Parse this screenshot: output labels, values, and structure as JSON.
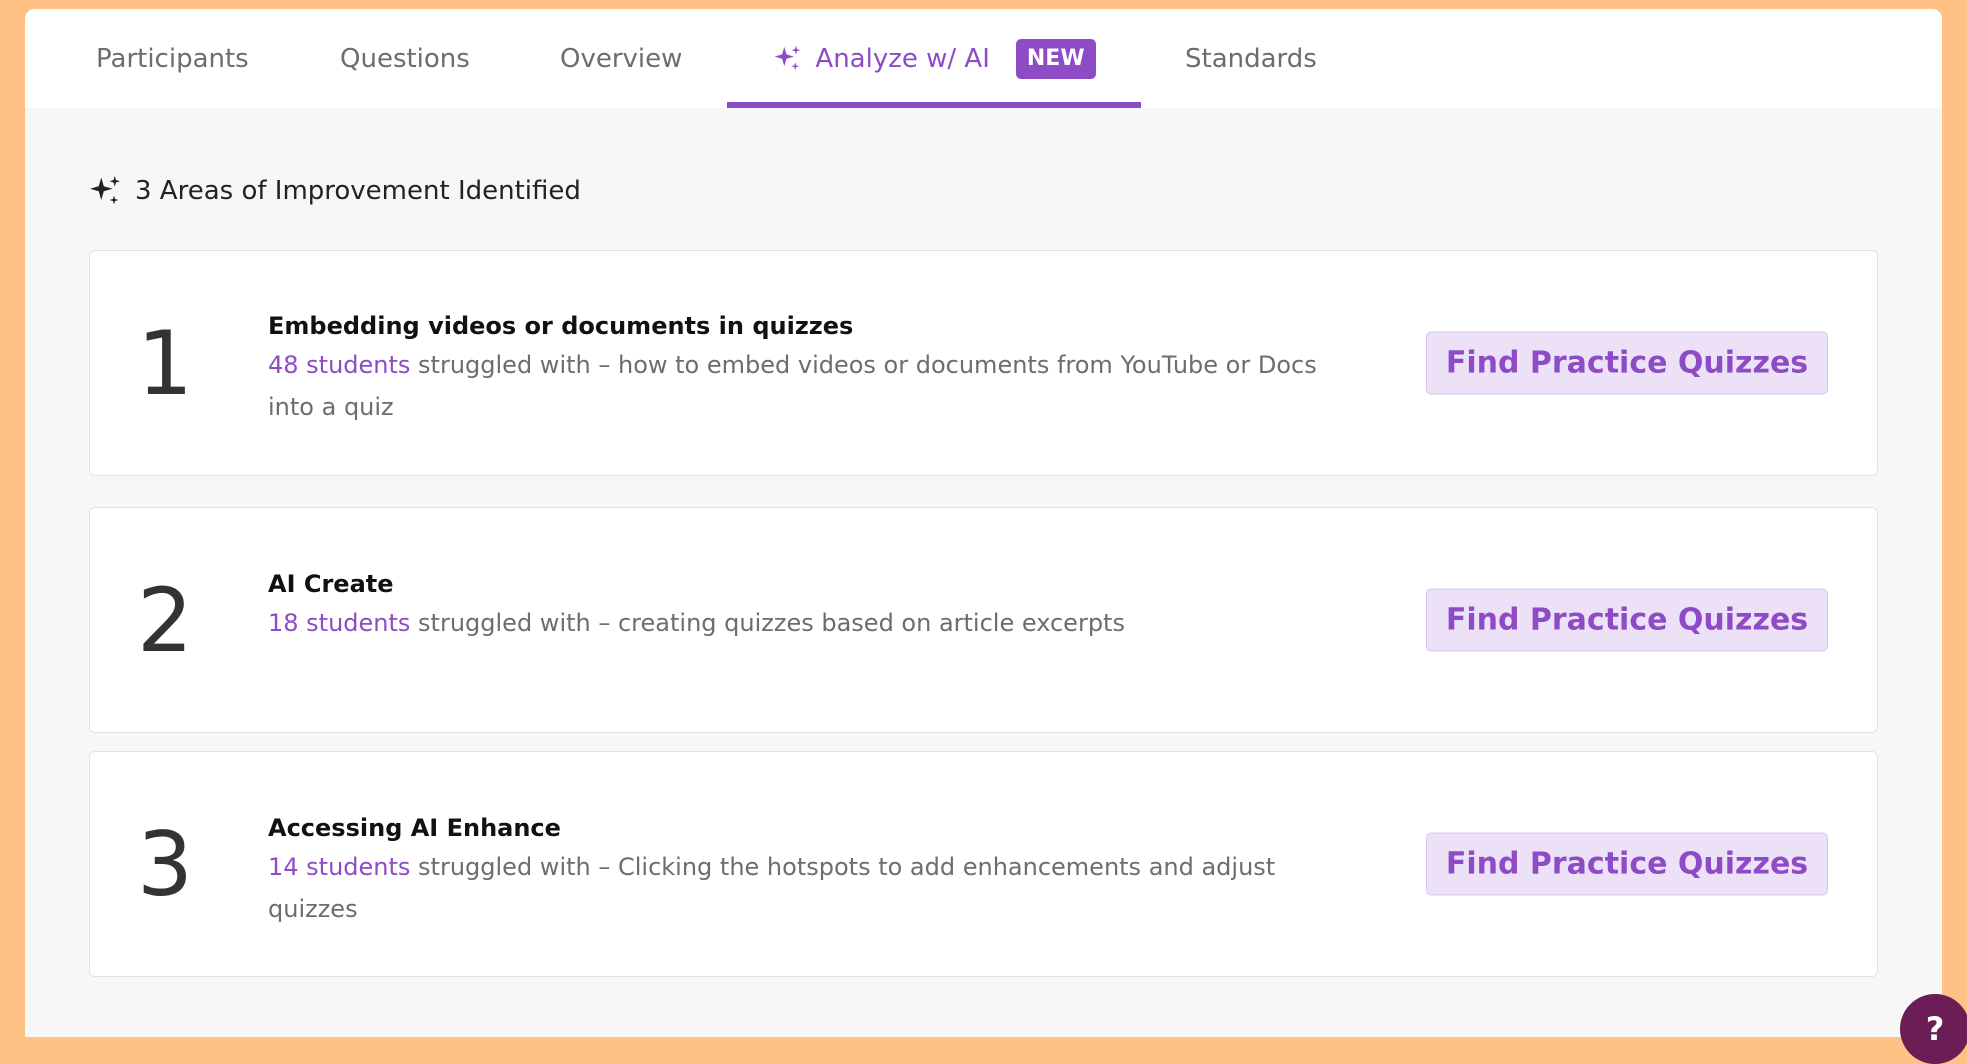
{
  "tabs": {
    "participants": "Participants",
    "questions": "Questions",
    "overview": "Overview",
    "analyze": "Analyze w/ AI",
    "new_badge": "NEW",
    "standards": "Standards"
  },
  "heading": "3 Areas of Improvement Identified",
  "cards": [
    {
      "number": "1",
      "title": "Embedding videos or documents in quizzes",
      "students": "48 students",
      "description": " struggled with – how to embed videos or documents from YouTube or Docs into a quiz",
      "button": "Find Practice Quizzes"
    },
    {
      "number": "2",
      "title": "AI Create",
      "students": "18 students",
      "description": " struggled with – creating quizzes based on article excerpts",
      "button": "Find Practice Quizzes"
    },
    {
      "number": "3",
      "title": "Accessing AI Enhance",
      "students": "14 students",
      "description": " struggled with – Clicking the hotspots to add enhancements and adjust quizzes",
      "button": "Find Practice Quizzes"
    }
  ],
  "help": {
    "label": "?"
  },
  "colors": {
    "accent": "#8D4CC6",
    "frame": "#FEC287",
    "button_bg": "#EDE1F8",
    "help_bg": "#6B1E55"
  },
  "icons": {
    "tab_analyze": "sparkle-icon",
    "heading": "sparkle-icon"
  }
}
